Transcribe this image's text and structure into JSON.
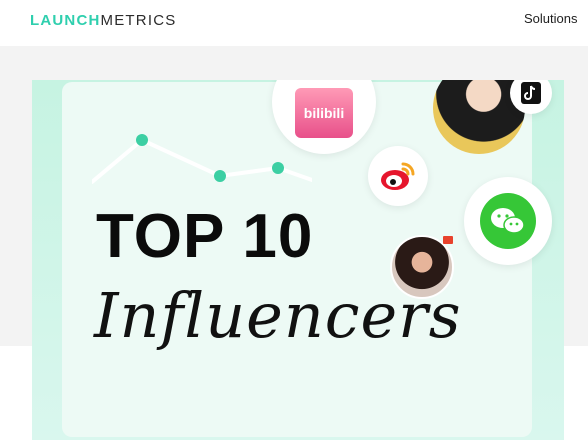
{
  "header": {
    "logo_part1": "LAUNCH",
    "logo_part2": "METRICS",
    "nav_solutions": "Solutions"
  },
  "banner": {
    "headline_line1": "TOP 10",
    "headline_line2": "Influencers",
    "platform_tile_text": "bilibili"
  },
  "icons": [
    "bilibili-icon",
    "weibo-icon",
    "wechat-icon",
    "tiktok-icon",
    "trend-line-icon"
  ],
  "colors": {
    "accent": "#2fcfae",
    "banner_bg": "#c6f3e2",
    "bilibili": "#e8508a",
    "wechat": "#36c737",
    "weibo": "#e6162d"
  }
}
